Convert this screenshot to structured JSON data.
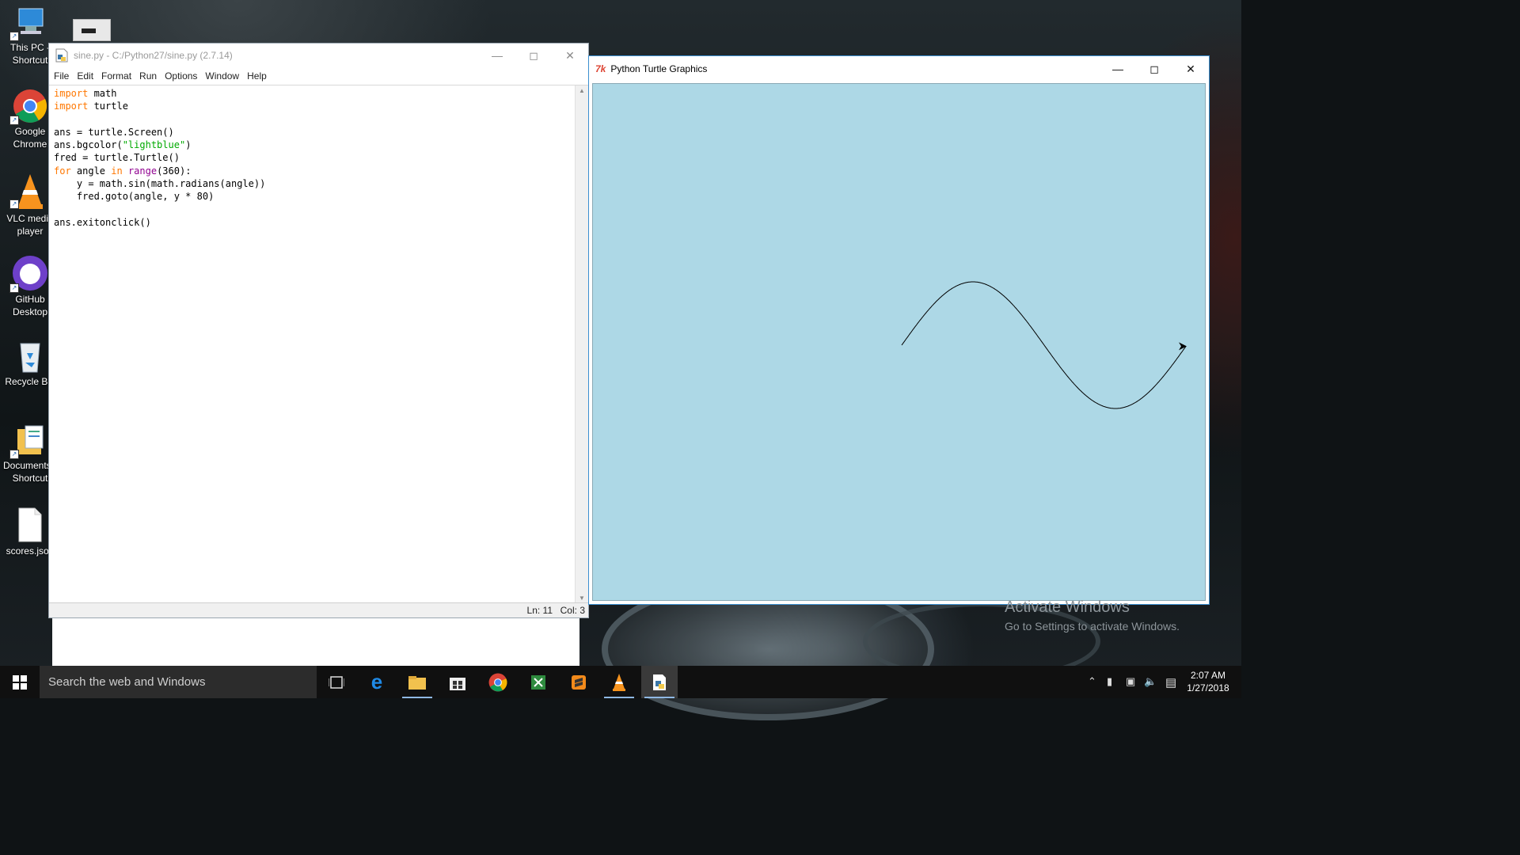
{
  "desktop": {
    "icons": [
      {
        "label": "This PC - Shortcut",
        "icon": "this-pc-icon"
      },
      {
        "label": "Google Chrome",
        "icon": "chrome-icon"
      },
      {
        "label": "VLC media player",
        "icon": "vlc-icon"
      },
      {
        "label": "GitHub Desktop",
        "icon": "github-icon"
      },
      {
        "label": "Recycle Bin",
        "icon": "recycle-bin-icon"
      },
      {
        "label": "Documents - Shortcut",
        "icon": "documents-icon"
      },
      {
        "label": "scores.json",
        "icon": "file-icon"
      }
    ],
    "activate": {
      "line1": "Activate Windows",
      "line2": "Go to Settings to activate Windows."
    }
  },
  "idle": {
    "title": "sine.py - C:/Python27/sine.py (2.7.14)",
    "menu": [
      "File",
      "Edit",
      "Format",
      "Run",
      "Options",
      "Window",
      "Help"
    ],
    "status": {
      "line": "Ln: 11",
      "col": "Col: 3"
    }
  },
  "turtle_window": {
    "title": "Python Turtle Graphics",
    "bgcolor": "#add8e6",
    "drawing": {
      "function": "sin",
      "x_range": [
        0,
        360
      ],
      "amplitude": 80
    }
  },
  "taskbar": {
    "search_placeholder": "Search the web and Windows",
    "apps": [
      "task-view-icon",
      "edge-icon",
      "file-explorer-icon",
      "store-icon",
      "chrome-icon",
      "excel-icon",
      "sublime-icon",
      "vlc-icon",
      "python-idle-icon"
    ],
    "time": "2:07 AM",
    "date": "1/27/2018"
  }
}
